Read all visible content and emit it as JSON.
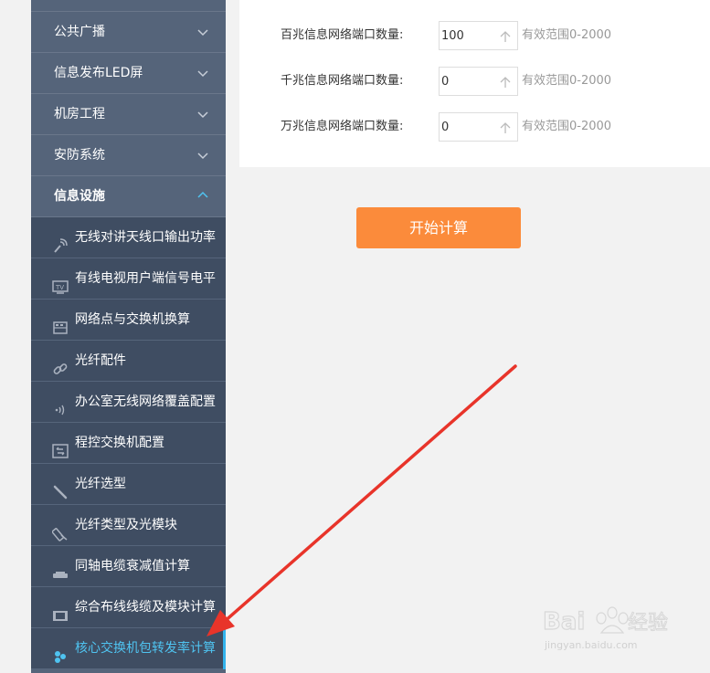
{
  "sidebar": {
    "categories": [
      {
        "label": "公共广播"
      },
      {
        "label": "信息发布LED屏"
      },
      {
        "label": "机房工程"
      },
      {
        "label": "安防系统"
      },
      {
        "label": "信息设施"
      }
    ],
    "items": [
      {
        "label": "无线对讲天线口输出功率",
        "icon": "antenna-icon"
      },
      {
        "label": "有线电视用户端信号电平",
        "icon": "tv-icon"
      },
      {
        "label": "网络点与交换机换算",
        "icon": "switch-icon"
      },
      {
        "label": "光纤配件",
        "icon": "link-icon"
      },
      {
        "label": "办公室无线网络覆盖配置",
        "icon": "wifi-signal-icon"
      },
      {
        "label": "程控交换机配置",
        "icon": "pbx-icon"
      },
      {
        "label": "光纤选型",
        "icon": "fiber-icon"
      },
      {
        "label": "光纤类型及光模块",
        "icon": "optical-module-icon"
      },
      {
        "label": "同轴电缆衰减值计算",
        "icon": "coax-cable-icon"
      },
      {
        "label": "综合布线线缆及模块计算",
        "icon": "cabling-icon"
      },
      {
        "label": "核心交换机包转发率计算",
        "icon": "core-switch-icon",
        "active": true
      }
    ]
  },
  "form": {
    "rows": [
      {
        "label": "百兆信息网络端口数量:",
        "value": "100",
        "hint": "有效范围0-2000"
      },
      {
        "label": "千兆信息网络端口数量:",
        "value": "0",
        "hint": "有效范围0-2000"
      },
      {
        "label": "万兆信息网络端口数量:",
        "value": "0",
        "hint": "有效范围0-2000"
      }
    ]
  },
  "actions": {
    "start_label": "开始计算"
  },
  "colors": {
    "sidebar_bg": "#3f4d62",
    "category_bg": "#55647a",
    "active_text": "#4fc3f0",
    "button_orange": "#fb8b3b",
    "annotation_arrow": "#e8342a"
  },
  "watermark": {
    "logo_text": "Baidu经验",
    "url": "jingyan.baidu.com"
  }
}
